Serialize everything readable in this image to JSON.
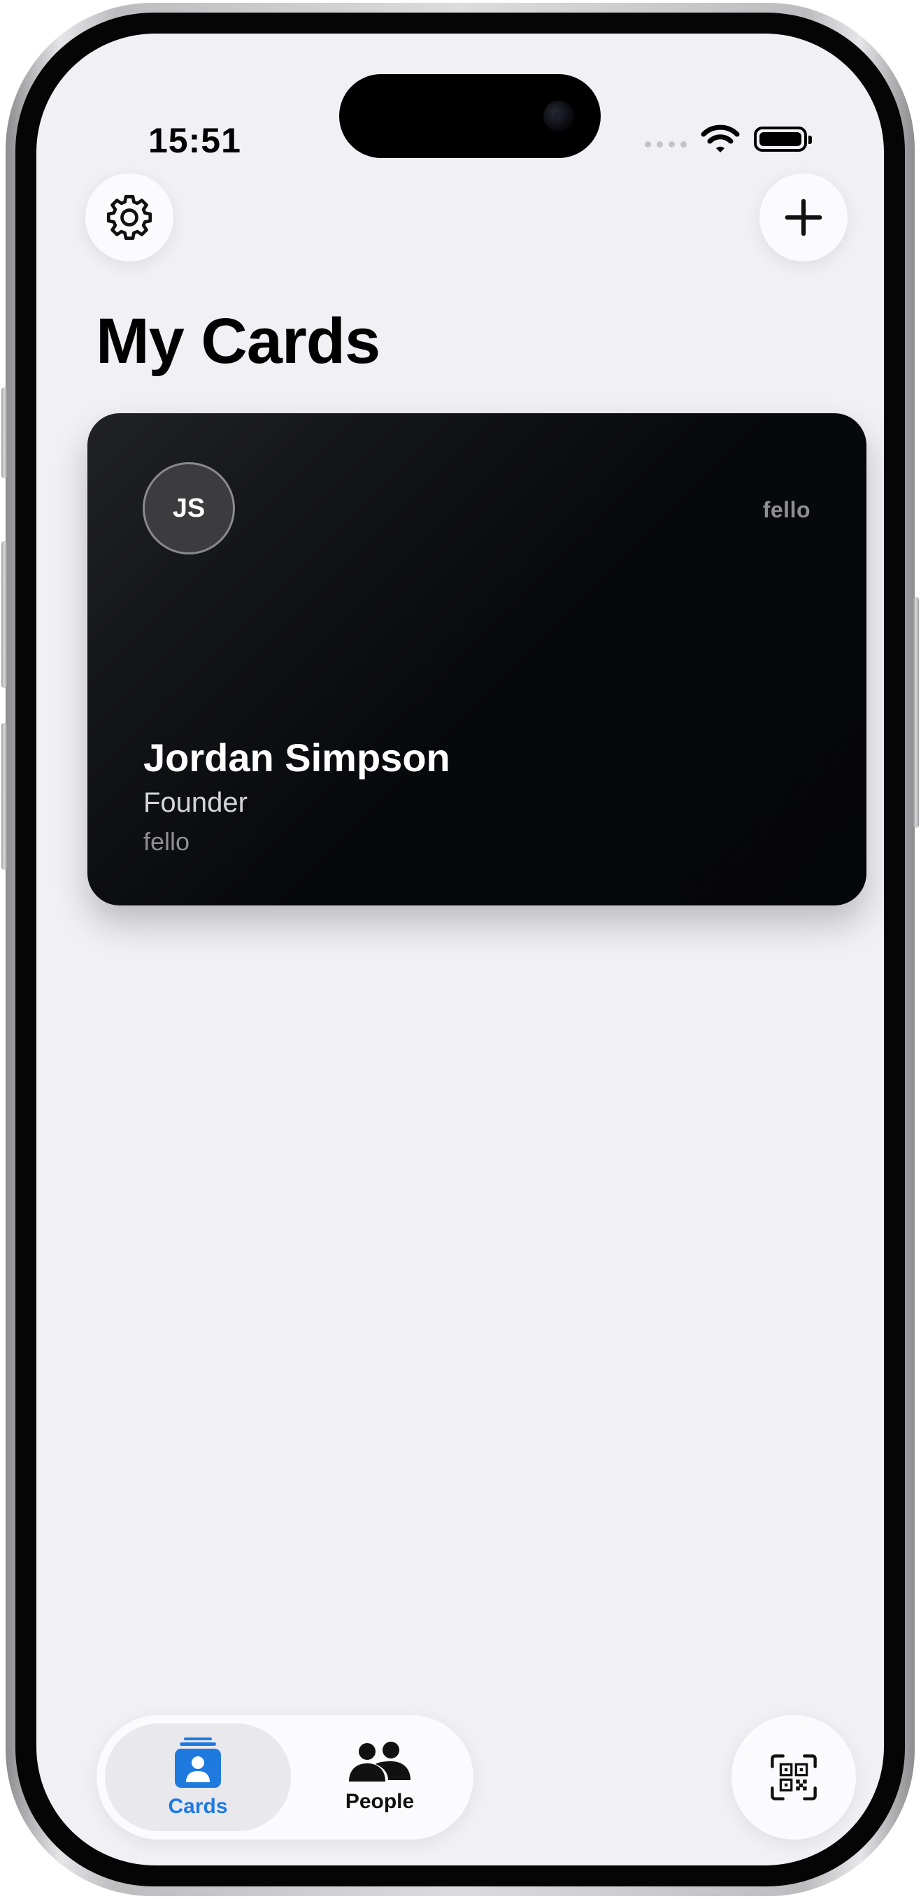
{
  "status_bar": {
    "time": "15:51"
  },
  "header": {
    "settings_icon": "gear-icon",
    "add_icon": "plus-icon",
    "title": "My Cards"
  },
  "card": {
    "initials": "JS",
    "company_top": "fello",
    "name": "Jordan Simpson",
    "role": "Founder",
    "company": "fello"
  },
  "tabbar": {
    "tabs": [
      {
        "label": "Cards",
        "icon": "cards-icon",
        "active": true
      },
      {
        "label": "People",
        "icon": "people-icon",
        "active": false
      }
    ],
    "scan_icon": "qr-scan-icon"
  },
  "colors": {
    "accent": "#1f7ae0",
    "background": "#f1f0f5",
    "card": "#07080c"
  }
}
